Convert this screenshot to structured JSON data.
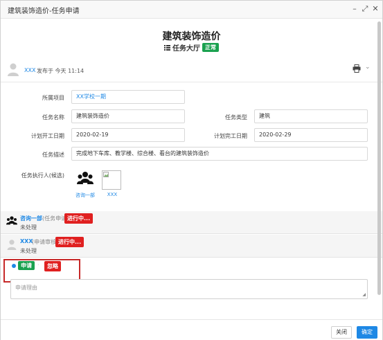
{
  "window": {
    "title": "建筑装饰造价-任务申请",
    "minimize": "–",
    "maximize": "⤢",
    "close": "✕"
  },
  "header": {
    "title": "建筑装饰造价",
    "sub_label": "任务大厅",
    "status_badge": "正常"
  },
  "poster": {
    "name": "XXX",
    "time": "发布于 今天 11:14"
  },
  "form": {
    "project_label": "所属项目",
    "project_value": "XX学校一期",
    "task_name_label": "任务名称",
    "task_name_value": "建筑装饰造价",
    "task_type_label": "任务类型",
    "task_type_value": "建筑",
    "plan_start_label": "计划开工日期",
    "plan_start_value": "2020-02-19",
    "plan_end_label": "计划完工日期",
    "plan_end_value": "2020-02-29",
    "desc_label": "任务描述",
    "desc_value": "完成地下车库、教学楼、综合楼、看台的建筑装饰造价",
    "executors_label": "任务执行人(候选)",
    "executors": [
      {
        "name": "咨询一部"
      },
      {
        "name": "XXX"
      }
    ]
  },
  "approvals": [
    {
      "name": "咨询一部",
      "role": "(任务申请)",
      "badge": "进行中...",
      "status": "未处理"
    },
    {
      "name": "XXX",
      "role": "(申请审核)",
      "badge": "进行中...",
      "status": "未处理"
    }
  ],
  "actions": {
    "apply_label": "申请",
    "ignore_label": "忽略",
    "reason_placeholder": "申请理由"
  },
  "footer": {
    "close_label": "关闭",
    "confirm_label": "确定"
  },
  "colors": {
    "accent": "#1e88e5",
    "success": "#1aa14f",
    "danger": "#e02020"
  }
}
